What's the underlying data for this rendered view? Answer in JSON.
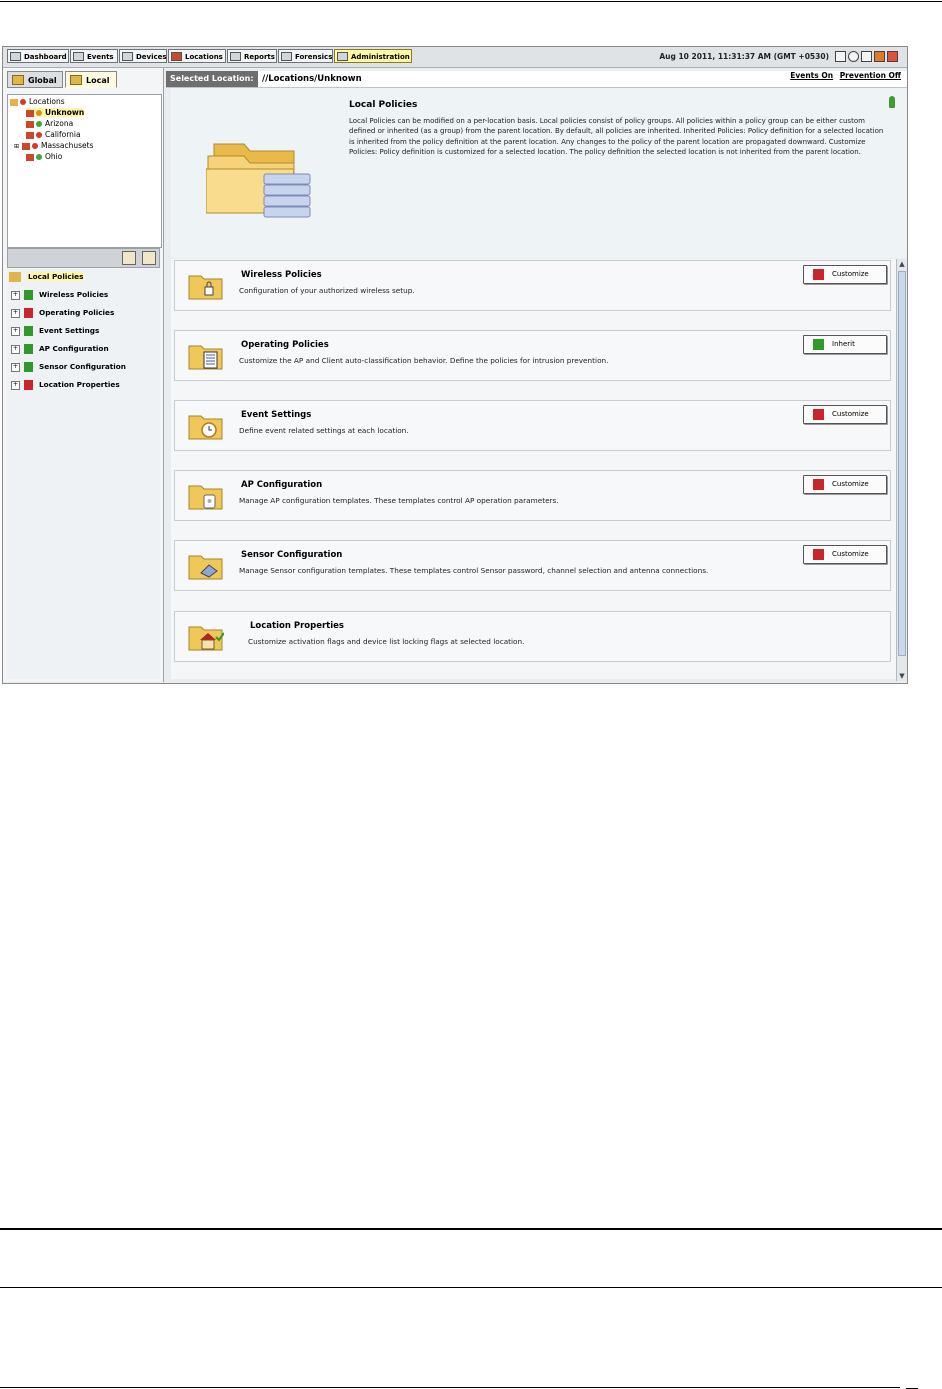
{
  "toolbar": {
    "tabs": [
      {
        "label": "Dashboard",
        "icon": "dashboard-icon"
      },
      {
        "label": "Events",
        "icon": "events-icon"
      },
      {
        "label": "Devices",
        "icon": "devices-icon"
      },
      {
        "label": "Locations",
        "icon": "locations-icon"
      },
      {
        "label": "Reports",
        "icon": "reports-icon"
      },
      {
        "label": "Forensics",
        "icon": "forensics-icon"
      },
      {
        "label": "Administration",
        "icon": "administration-icon",
        "active": true
      }
    ],
    "datetime": "Aug 10 2011, 11:31:37 AM (GMT +0530)"
  },
  "left": {
    "tabs": [
      {
        "label": "Global"
      },
      {
        "label": "Local",
        "selected": true
      }
    ],
    "location_tree": [
      {
        "label": "Locations",
        "level": 0
      },
      {
        "label": "Unknown",
        "level": 1,
        "selected": true,
        "status": "orange"
      },
      {
        "label": "Arizona",
        "level": 1,
        "status": "green"
      },
      {
        "label": "California",
        "level": 1,
        "status": "red"
      },
      {
        "label": "Massachusets",
        "level": 1,
        "status": "red"
      },
      {
        "label": "Ohio",
        "level": 1,
        "status": "green"
      }
    ],
    "policy_tree": {
      "root": "Local Policies",
      "items": [
        {
          "label": "Wireless Policies",
          "state": "customized"
        },
        {
          "label": "Operating Policies",
          "state": "customized"
        },
        {
          "label": "Event Settings",
          "state": "inherited"
        },
        {
          "label": "AP Configuration",
          "state": "inherited"
        },
        {
          "label": "Sensor Configuration",
          "state": "inherited"
        },
        {
          "label": "Location Properties",
          "state": "customized"
        }
      ]
    }
  },
  "right": {
    "selected_location_label": "Selected Location:",
    "selected_location_path": "//Locations/Unknown",
    "links": {
      "events": "Events On",
      "prevention": "Prevention Off"
    },
    "intro": {
      "title": "Local Policies",
      "text": "Local Policies can be modified on a per-location basis. Local policies consist of policy groups. All policies within a policy group can be either custom defined or inherited (as a group) from the parent location. By default, all policies are inherited. Inherited Policies: Policy definition for a selected location is inherited from the policy definition at the parent location. Any changes to the policy of the parent location are propagated downward. Customize Policies: Policy definition is customized for a selected location. The policy definition the selected location is not inherited from the parent location."
    },
    "items": [
      {
        "title": "Wireless Policies",
        "desc": "Configuration of your authorized wireless setup.",
        "button": "Customize",
        "icon": "folder-lock-icon"
      },
      {
        "title": "Operating Policies",
        "desc": "Customize the AP and Client auto-classification behavior. Define the policies for intrusion prevention.",
        "button": "Inherit",
        "icon": "folder-document-icon"
      },
      {
        "title": "Event Settings",
        "desc": "Define event related settings at each location.",
        "button": "Customize",
        "icon": "folder-clock-icon"
      },
      {
        "title": "AP Configuration",
        "desc": "Manage AP configuration templates. These templates control AP operation parameters.",
        "button": "Customize",
        "icon": "folder-ap-icon"
      },
      {
        "title": "Sensor Configuration",
        "desc": "Manage Sensor configuration templates. These templates control Sensor password, channel selection and antenna connections.",
        "button": "Customize",
        "icon": "folder-sensor-icon"
      },
      {
        "title": "Location Properties",
        "desc": "Customize activation flags and device list locking flags at selected location.",
        "button": null,
        "icon": "folder-house-icon"
      }
    ]
  },
  "colors": {
    "active_tab": "#fff7a6",
    "customized": "#c8262a",
    "inherited": "#2f9a2a",
    "folder": "#f0c85a"
  }
}
